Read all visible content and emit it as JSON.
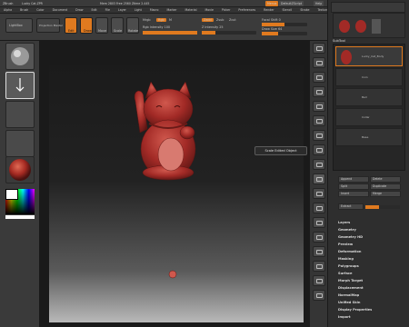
{
  "titlebar": {
    "app": "ZBrush",
    "file": "Lucky Cat.ZPR",
    "info": "Mem 2803 Free 2560 Ztime 2.445",
    "right_btn_1": "Menus",
    "right_btn_2": "DefaultZScript",
    "right_btn_3": "Help"
  },
  "menu": [
    "Alpha",
    "Brush",
    "Color",
    "Document",
    "Draw",
    "Edit",
    "File",
    "Layer",
    "Light",
    "Macro",
    "Marker",
    "Material",
    "Movie",
    "Picker",
    "Preferences",
    "Render",
    "Stencil",
    "Stroke",
    "Texture",
    "Tool",
    "Transform",
    "Zplugin",
    "Zscript"
  ],
  "toptools": {
    "lightbox_label": "LightBox",
    "projection_label": "Projection Master",
    "edit_label": "Edit",
    "draw_label": "Draw",
    "move_label": "Move",
    "scale_label": "Scale",
    "rotate_label": "Rotate",
    "mrgb_label": "Mrgb",
    "rgb_label": "Rgb",
    "m_label": "M",
    "rgb_intensity_label": "Rgb Intensity 100",
    "zadd_label": "Zadd",
    "zsub_label": "Zsub",
    "zcut_label": "Zcut",
    "z_intensity_label": "Z Intensity 25",
    "focal_label": "Focal Shift 0",
    "draw_size_label": "Draw Size 64"
  },
  "right_panel": {
    "tool_items": [
      "Load Tool",
      "Save As",
      "Copy Tool",
      "Paste Tool",
      "Import",
      "Export",
      "Clone",
      "Make PolyMesh3D",
      "GoZ",
      "All",
      "Visible",
      "R"
    ],
    "subtool_header": "SubTool",
    "subtool_names": [
      "Lucky_Cat_Body",
      "Coin",
      "Bell",
      "Collar",
      "Base"
    ],
    "subtool_buttons": [
      "Append",
      "Delete",
      "Split",
      "Duplicate",
      "Insert",
      "Merge"
    ],
    "extract_label": "Extract",
    "sections": [
      "Layers",
      "Geometry",
      "Geometry HD",
      "Preview",
      "Deformation",
      "Masking",
      "Polygroups",
      "Surface",
      "Morph Target",
      "Displacement",
      "NormalMap",
      "Unified Skin",
      "Display Properties",
      "Import"
    ]
  },
  "tooltip": "Scale Edited Object",
  "left_tray": {
    "lightbox_btn": "LightBox"
  },
  "colors": {
    "accent": "#e07a1f",
    "model": "#b2302e",
    "background": "#2a2a2a"
  }
}
